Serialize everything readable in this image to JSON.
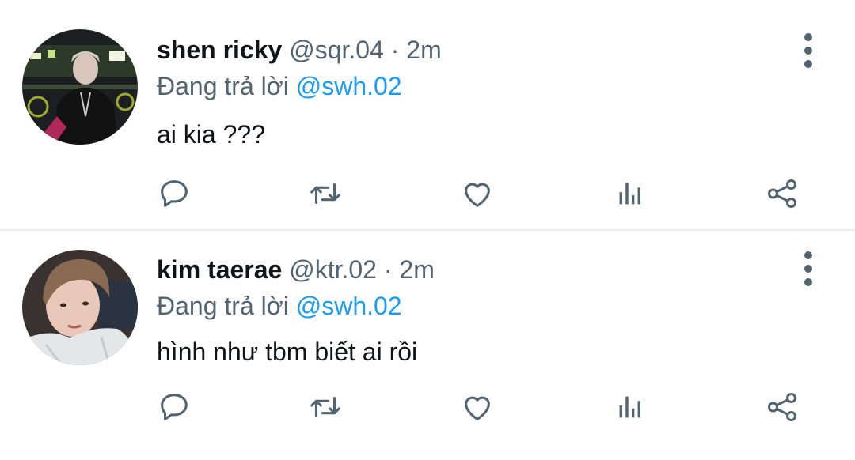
{
  "colors": {
    "text": "#0f1419",
    "muted": "#536471",
    "mention": "#1d9bf0",
    "divider": "#e7ecf0"
  },
  "replies": [
    {
      "name": "shen ricky",
      "handle": "@sqr.04",
      "separator": "·",
      "time": "2m",
      "replying_prefix": "Đang trả lời",
      "replying_to": "@swh.02",
      "text": "ai kia ???",
      "actions": [
        "reply-icon",
        "retweet-icon",
        "like-icon",
        "analytics-icon",
        "share-icon"
      ]
    },
    {
      "name": "kim taerae",
      "handle": "@ktr.02",
      "separator": "·",
      "time": "2m",
      "replying_prefix": "Đang trả lời",
      "replying_to": "@swh.02",
      "text": "hình như tbm biết ai rồi",
      "actions": [
        "reply-icon",
        "retweet-icon",
        "like-icon",
        "analytics-icon",
        "share-icon"
      ]
    }
  ]
}
